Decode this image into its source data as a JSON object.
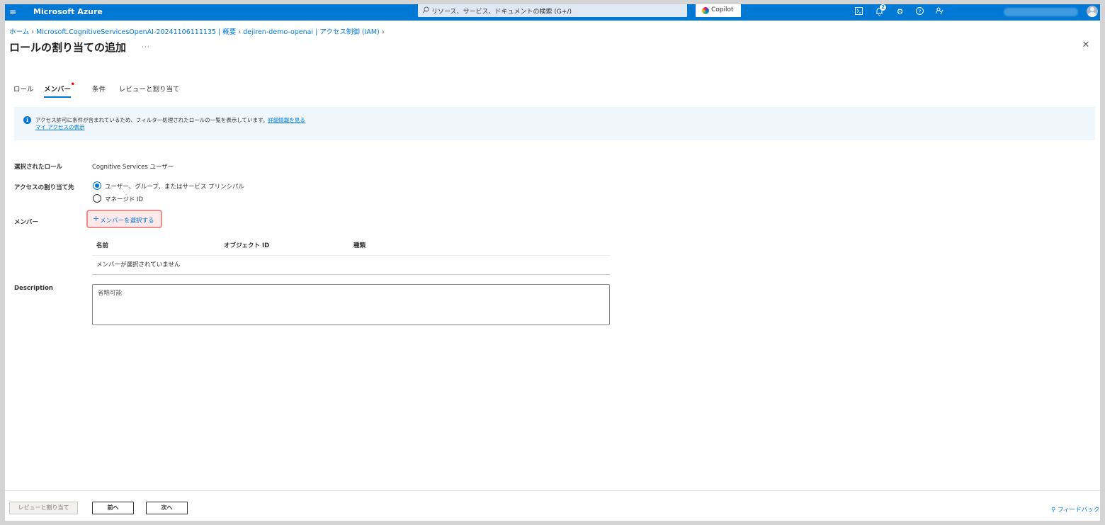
{
  "topbar": {
    "brand": "Microsoft Azure",
    "search_placeholder": "リソース、サービス、ドキュメントの検索 (G+/)",
    "copilot_label": "Copilot",
    "notification_count": "2"
  },
  "breadcrumb": {
    "items": [
      "ホーム",
      "Microsoft.CognitiveServicesOpenAI-20241106111135 | 概要",
      "dejiren-demo-openai | アクセス制御 (IAM)"
    ]
  },
  "page": {
    "title": "ロールの割り当ての追加",
    "ellipsis": "···"
  },
  "tabs": [
    {
      "label": "ロール"
    },
    {
      "label": "メンバー",
      "required": "•"
    },
    {
      "label": "条件"
    },
    {
      "label": "レビューと割り当て"
    }
  ],
  "info": {
    "text": "アクセス許可に条件が含まれているため、フィルター処理されたロールの一覧を表示しています。",
    "link1": "詳細情報を見る",
    "link2": "マイ アクセスの表示"
  },
  "form": {
    "selected_role_label": "選択されたロール",
    "selected_role_value": "Cognitive Services ユーザー",
    "assign_to_label": "アクセスの割り当て先",
    "option_user": "ユーザー、グループ、またはサービス プリンシパル",
    "option_managed": "マネージド ID",
    "members_label": "メンバー",
    "select_members": "メンバーを選択する",
    "columns": [
      "名前",
      "オブジェクト ID",
      "種類"
    ],
    "no_members": "メンバーが選択されていません",
    "description_label": "Description",
    "description_placeholder": "省略可能"
  },
  "footer": {
    "review_assign": "レビューと割り当て",
    "prev": "前へ",
    "next": "次へ",
    "feedback": "フィードバック"
  }
}
